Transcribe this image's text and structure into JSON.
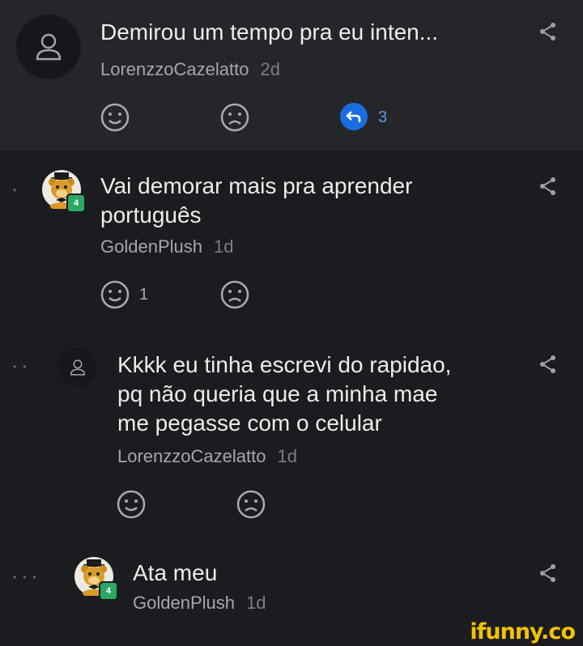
{
  "comments": [
    {
      "text": "Demirou um tempo pra eu inten...",
      "author": "LorenzzoCazelatto",
      "time": "2d",
      "reply_count": "3"
    },
    {
      "text_lines": [
        "Vai demorar mais pra aprender",
        "português"
      ],
      "author": "GoldenPlush",
      "time": "1d",
      "level": "4",
      "smile_count": "1"
    },
    {
      "text_lines": [
        "Kkkk eu tinha escrevi do rapidao,",
        "pq não queria que a minha mae",
        "me pegasse com o celular"
      ],
      "author": "LorenzzoCazelatto",
      "time": "1d"
    },
    {
      "text": "Ata meu",
      "author": "GoldenPlush",
      "time": "1d",
      "level": "4"
    }
  ],
  "watermark": "ifunny.co",
  "icons": [
    "user-icon",
    "share-icon",
    "smile-icon",
    "frown-icon",
    "reply-icon"
  ],
  "colors": {
    "accent": "#1a6de0",
    "badge": "#2aa864",
    "watermark": "#f2c200"
  }
}
